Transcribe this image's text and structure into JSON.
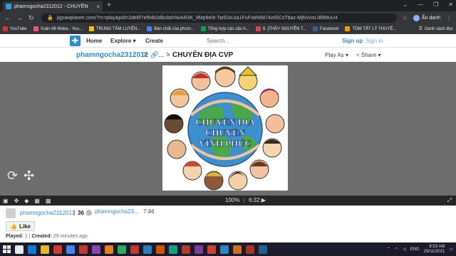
{
  "browser": {
    "tab_title": "phamngocha2312012 - CHUYÊN",
    "tab_close": "×",
    "new_tab": "+",
    "url": "jigsawplanet.com/?rc=play&pid=2de6f7ef64b3dbcbd=lwAR3K_9Mp9e0t-TarlDxLka1FuFxbN687AelSCsTbaz-MjNVosL9f8MuU4",
    "profile_label": "Ẩn danh",
    "window_controls": [
      "⌄",
      "—",
      "❐",
      "✕"
    ],
    "nav": [
      "←",
      "→",
      "↻"
    ],
    "bookmarks": [
      {
        "label": "YouTube",
        "icon": "youtube-icon"
      },
      {
        "label": "Xuân 88 Moba - You...",
        "icon": "youtube-icon"
      },
      {
        "label": "TRUNG TÂM LUYỆN...",
        "icon": "bookmark-icon"
      },
      {
        "label": "Bản chất của phươ...",
        "icon": "google-icon"
      },
      {
        "label": "Tổng hợp các câu h...",
        "icon": "bookmark-icon"
      },
      {
        "label": "8. [THẦY NGUYỄN T...",
        "icon": "youtube-icon"
      },
      {
        "label": "Facebook",
        "icon": "facebook-icon"
      },
      {
        "label": "TÓM TẮT LÝ THUYẾ...",
        "icon": "bookmark-icon"
      }
    ],
    "bookmarks_other": "Danh sách đọc"
  },
  "site": {
    "nav_home": "Home",
    "nav_explore": "Explore ▾",
    "nav_create": "Create",
    "search_placeholder": "Search...",
    "signup": "Sign up",
    "divider": "|",
    "signin": "Sign in"
  },
  "titlebar": {
    "user": "phamngocha2312012",
    "sep": ">",
    "link_icon": "🔗",
    "ellipsis": "...",
    "title": "CHUYÊN ĐỊA CVP",
    "play_as": "Play As ▾",
    "share": "< Share ▾"
  },
  "puzzle": {
    "text_lines": [
      "CHUYÊN ĐỊA",
      "CHUYÊN",
      "VĨNH PHÚC"
    ]
  },
  "controls": {
    "percent": "100%",
    "sep": "|",
    "time": "6:32 ▶"
  },
  "info": {
    "user": "phamngocha2312012",
    "bar": "|",
    "pieces": "36",
    "user2": "phamngocha23...",
    "time": "7:46",
    "like": "Like",
    "played_label": "Played:",
    "played_value": "2",
    "created_label": "Created:",
    "created_value": "29 minutes ago"
  },
  "taskbar": {
    "clock_time": "8:53 AM",
    "clock_date": "29/11/2021",
    "lang": "ENG"
  }
}
